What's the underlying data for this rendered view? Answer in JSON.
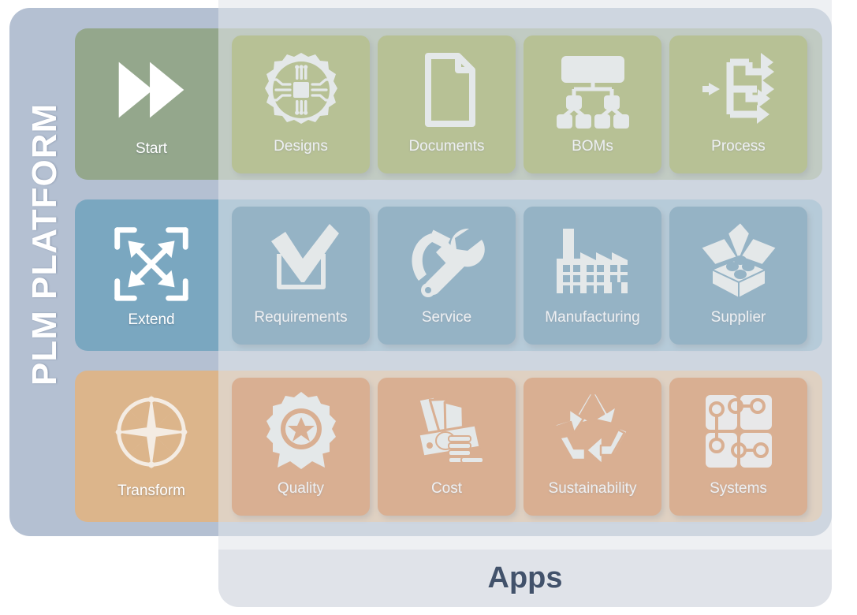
{
  "platform": {
    "title": "PLM PLATFORM",
    "shell_color": "#b4c0d2"
  },
  "footer": {
    "label": "Apps",
    "text_color": "#42526b",
    "panel_color": "#e0e3e9"
  },
  "rows": [
    {
      "id": "start",
      "band_color": "#94a78c",
      "tile_color": "#7d8f1f",
      "stage": {
        "label": "Start",
        "icon": "fast-forward-icon"
      },
      "tiles": [
        {
          "label": "Designs",
          "icon": "gear-chip-icon"
        },
        {
          "label": "Documents",
          "icon": "document-page-icon"
        },
        {
          "label": "BOMs",
          "icon": "hierarchy-tree-icon"
        },
        {
          "label": "Process",
          "icon": "process-flow-arrows-icon"
        }
      ]
    },
    {
      "id": "extend",
      "band_color": "#7aa7c0",
      "tile_color": "#2d6e92",
      "stage": {
        "label": "Extend",
        "icon": "expand-arrows-icon"
      },
      "tiles": [
        {
          "label": "Requirements",
          "icon": "checkmark-box-icon"
        },
        {
          "label": "Service",
          "icon": "hammer-wrench-icon"
        },
        {
          "label": "Manufacturing",
          "icon": "factory-icon"
        },
        {
          "label": "Supplier",
          "icon": "open-box-icon"
        }
      ]
    },
    {
      "id": "transform",
      "band_color": "#dcb58b",
      "tile_color": "#cc6418",
      "stage": {
        "label": "Transform",
        "icon": "compass-rose-icon"
      },
      "tiles": [
        {
          "label": "Quality",
          "icon": "award-ribbon-icon"
        },
        {
          "label": "Cost",
          "icon": "money-coins-icon"
        },
        {
          "label": "Sustainability",
          "icon": "recycle-icon"
        },
        {
          "label": "Systems",
          "icon": "systems-nodes-icon"
        }
      ]
    }
  ]
}
